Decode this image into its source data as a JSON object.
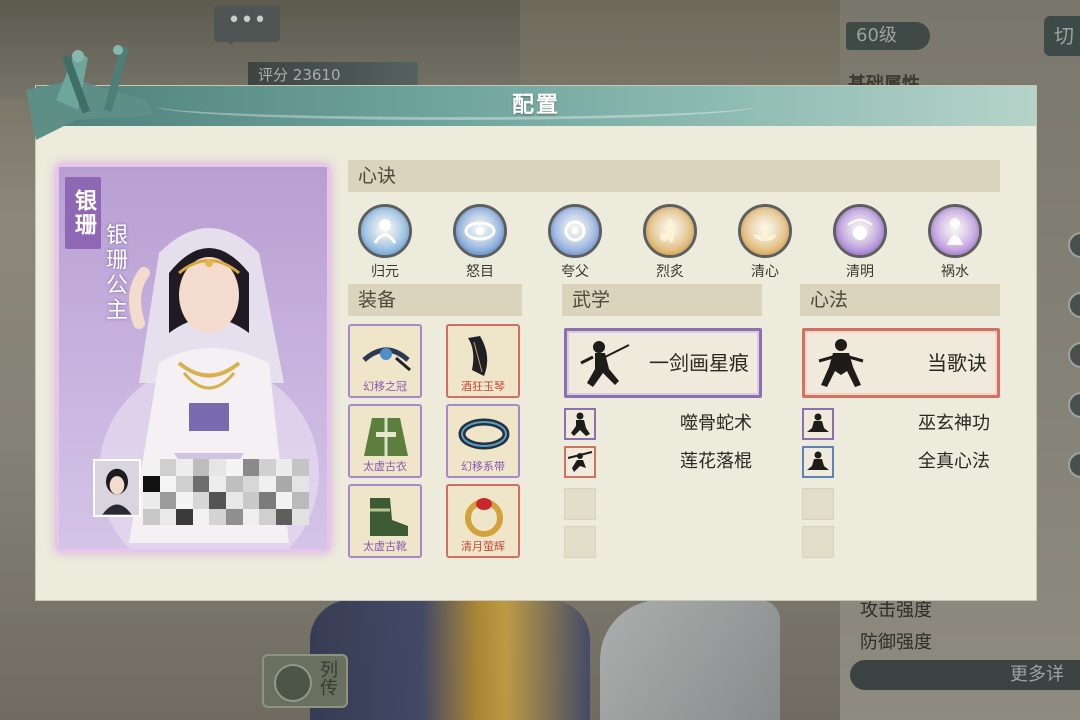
{
  "background": {
    "level_badge": "60级",
    "switch_glyph": "切",
    "attribute_title": "基础属性",
    "score_label": "评分",
    "score_value": "23610",
    "chat_glyph": "•••",
    "stats": [
      "攻击强度",
      "防御强度"
    ],
    "more_button": "更多详",
    "biography_button": "列传"
  },
  "modal": {
    "title": "配置",
    "character": {
      "banner": "银珊",
      "name": "银珊公主"
    },
    "sections": {
      "xinjue": "心诀",
      "equipment": "装备",
      "martial": "武学",
      "mind_method": "心法"
    },
    "xinjue_skills": [
      {
        "label": "归元",
        "icon": "blue-spirit-icon",
        "color": "#6aa2d8"
      },
      {
        "label": "怒目",
        "icon": "eye-icon",
        "color": "#5f8fd1"
      },
      {
        "label": "夸父",
        "icon": "orb-icon",
        "color": "#6f95d6"
      },
      {
        "label": "烈炙",
        "icon": "flame-spirit-icon",
        "color": "#d7a24a"
      },
      {
        "label": "清心",
        "icon": "lotus-icon",
        "color": "#d9a44d"
      },
      {
        "label": "清明",
        "icon": "pearl-icon",
        "color": "#9a6fd0"
      },
      {
        "label": "祸水",
        "icon": "maiden-icon",
        "color": "#a97ad6"
      }
    ],
    "equipment": [
      {
        "label": "幻移之冠",
        "icon": "crown-icon",
        "rarity": "purple"
      },
      {
        "label": "酒狂玉琴",
        "icon": "guqin-icon",
        "rarity": "red"
      },
      {
        "label": "太虚古衣",
        "icon": "robe-icon",
        "rarity": "purple"
      },
      {
        "label": "幻移系带",
        "icon": "belt-icon",
        "rarity": "purple"
      },
      {
        "label": "太虚古靴",
        "icon": "boots-icon",
        "rarity": "purple"
      },
      {
        "label": "清月萤辉",
        "icon": "ring-icon",
        "rarity": "red"
      }
    ],
    "martial": {
      "main": {
        "name": "一剑画星痕",
        "icon": "swordsman-icon",
        "rarity": "purple"
      },
      "subs": [
        {
          "name": "噬骨蛇术",
          "icon": "snake-fist-icon",
          "rarity": "purple"
        },
        {
          "name": "莲花落棍",
          "icon": "staff-icon",
          "rarity": "red"
        }
      ]
    },
    "mind": {
      "main": {
        "name": "当歌诀",
        "icon": "stance-icon",
        "rarity": "red"
      },
      "subs": [
        {
          "name": "巫玄神功",
          "icon": "meditate-icon",
          "rarity": "purple"
        },
        {
          "name": "全真心法",
          "icon": "meditate-icon",
          "rarity": "blue"
        }
      ]
    }
  }
}
